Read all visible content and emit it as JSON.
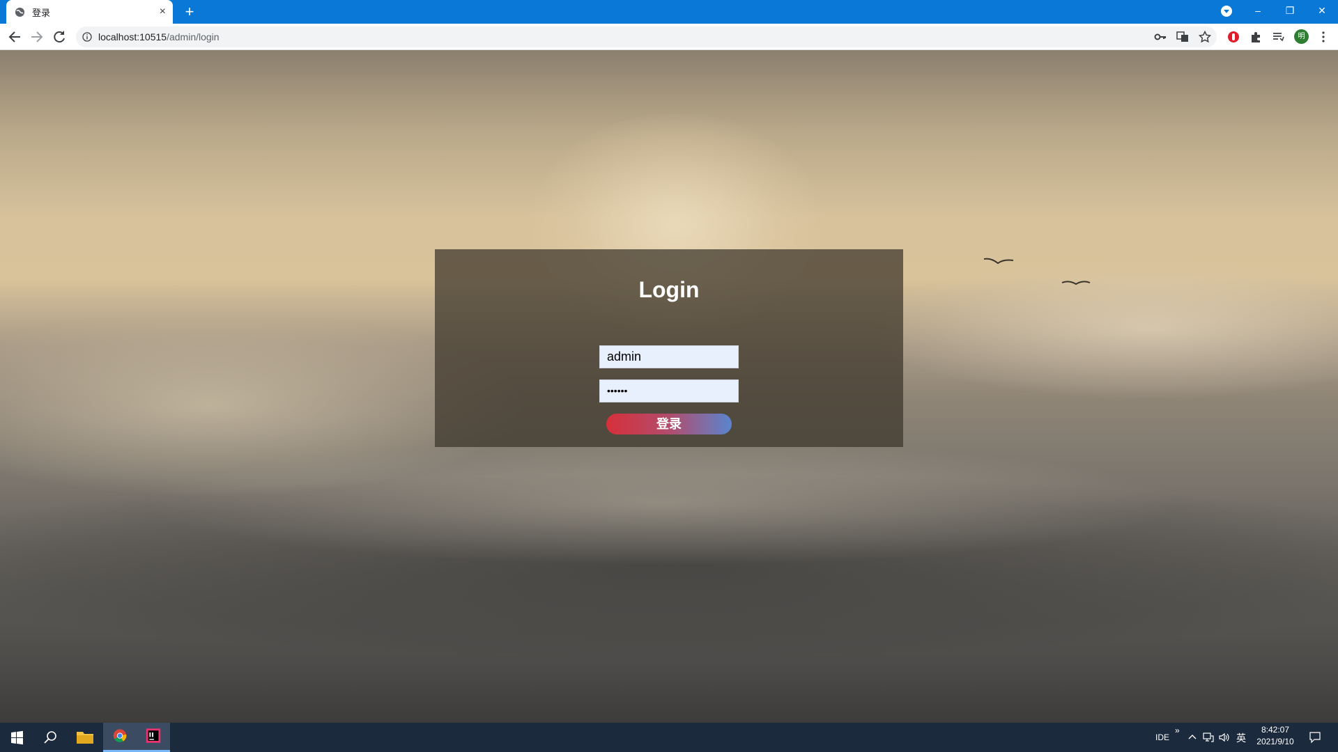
{
  "browser": {
    "tab_title": "登录",
    "tab_close": "×",
    "new_tab": "+",
    "window_controls": {
      "minimize": "–",
      "restore": "❐",
      "close": "✕"
    },
    "url_host": "localhost:10515",
    "url_path": "/admin/login",
    "avatar_initial": "明",
    "icons": [
      "back-icon",
      "forward-icon",
      "reload-icon",
      "info-icon",
      "key-icon",
      "translate-icon",
      "star-icon",
      "extension-red-icon",
      "puzzle-icon",
      "reading-list-icon",
      "menu-icon"
    ]
  },
  "login": {
    "title": "Login",
    "username_value": "admin",
    "password_value": "••••••",
    "submit_label": "登录",
    "button_gradient": [
      "#d6303a",
      "#5a85cf"
    ]
  },
  "taskbar": {
    "ide_label": "IDE",
    "overflow": "»",
    "ime_label": "英",
    "time": "8:42:07",
    "date": "2021/9/10"
  }
}
